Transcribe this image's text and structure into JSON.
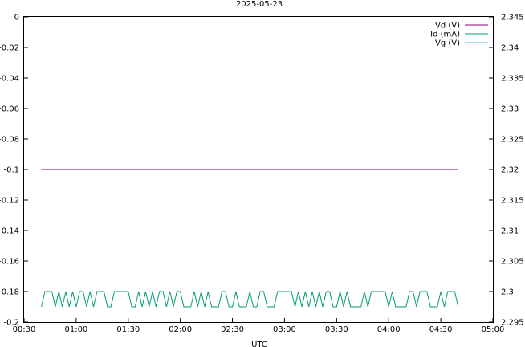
{
  "chart_data": {
    "type": "line",
    "title": "2025-05-23",
    "xlabel": "UTC",
    "x_unit": "time of day (UTC)",
    "xlim": [
      "00:30",
      "05:00"
    ],
    "ylim_left": [
      -0.2,
      0
    ],
    "ylim_right": [
      2.295,
      2.345
    ],
    "x_ticks": [
      "00:30",
      "01:00",
      "01:30",
      "02:00",
      "02:30",
      "03:00",
      "03:30",
      "04:00",
      "04:30",
      "05:00"
    ],
    "y_ticks_left": [
      "0",
      "-0.02",
      "-0.04",
      "-0.06",
      "-0.08",
      "-0.1",
      "-0.12",
      "-0.14",
      "-0.16",
      "-0.18",
      "-0.2"
    ],
    "y_ticks_right": [
      "2.345",
      "2.34",
      "2.335",
      "2.33",
      "2.325",
      "2.32",
      "2.315",
      "2.31",
      "2.305",
      "2.3",
      "2.295"
    ],
    "legend_position": "top-right",
    "grid": false,
    "series": [
      {
        "name": "Vd (V)",
        "axis": "right",
        "color": "#94007f",
        "x": [
          "00:40",
          "04:40"
        ],
        "values": [
          2.32,
          2.32
        ]
      },
      {
        "name": "Id (mA)",
        "axis": "left",
        "color": "#009e73",
        "x": [
          "00:40",
          "00:42",
          "00:44",
          "00:46",
          "00:48",
          "00:50",
          "00:52",
          "00:54",
          "00:56",
          "00:58",
          "01:00",
          "01:02",
          "01:04",
          "01:06",
          "01:08",
          "01:10",
          "01:12",
          "01:14",
          "01:16",
          "01:18",
          "01:20",
          "01:22",
          "01:24",
          "01:26",
          "01:28",
          "01:30",
          "01:32",
          "01:34",
          "01:36",
          "01:38",
          "01:40",
          "01:42",
          "01:44",
          "01:46",
          "01:48",
          "01:50",
          "01:52",
          "01:54",
          "01:56",
          "01:58",
          "02:00",
          "02:02",
          "02:04",
          "02:06",
          "02:08",
          "02:10",
          "02:12",
          "02:14",
          "02:16",
          "02:18",
          "02:20",
          "02:22",
          "02:24",
          "02:26",
          "02:28",
          "02:30",
          "02:32",
          "02:34",
          "02:36",
          "02:38",
          "02:40",
          "02:42",
          "02:44",
          "02:46",
          "02:48",
          "02:50",
          "02:52",
          "02:54",
          "02:56",
          "02:58",
          "03:00",
          "03:02",
          "03:04",
          "03:06",
          "03:08",
          "03:10",
          "03:12",
          "03:14",
          "03:16",
          "03:18",
          "03:20",
          "03:22",
          "03:24",
          "03:26",
          "03:28",
          "03:30",
          "03:32",
          "03:34",
          "03:36",
          "03:38",
          "03:40",
          "03:42",
          "03:44",
          "03:46",
          "03:48",
          "03:50",
          "03:52",
          "03:54",
          "03:56",
          "03:58",
          "04:00",
          "04:02",
          "04:04",
          "04:06",
          "04:08",
          "04:10",
          "04:12",
          "04:14",
          "04:16",
          "04:18",
          "04:20",
          "04:22",
          "04:24",
          "04:26",
          "04:28",
          "04:30",
          "04:32",
          "04:34",
          "04:36",
          "04:38",
          "04:40"
        ],
        "values": [
          -0.19,
          -0.18,
          -0.18,
          -0.18,
          -0.19,
          -0.18,
          -0.19,
          -0.18,
          -0.19,
          -0.18,
          -0.19,
          -0.18,
          -0.18,
          -0.19,
          -0.18,
          -0.19,
          -0.18,
          -0.18,
          -0.18,
          -0.19,
          -0.19,
          -0.18,
          -0.18,
          -0.18,
          -0.18,
          -0.18,
          -0.19,
          -0.19,
          -0.18,
          -0.19,
          -0.18,
          -0.19,
          -0.18,
          -0.19,
          -0.18,
          -0.18,
          -0.19,
          -0.18,
          -0.19,
          -0.18,
          -0.18,
          -0.19,
          -0.19,
          -0.19,
          -0.18,
          -0.19,
          -0.18,
          -0.19,
          -0.18,
          -0.19,
          -0.19,
          -0.19,
          -0.18,
          -0.18,
          -0.19,
          -0.19,
          -0.18,
          -0.19,
          -0.19,
          -0.19,
          -0.18,
          -0.19,
          -0.19,
          -0.18,
          -0.18,
          -0.19,
          -0.19,
          -0.19,
          -0.18,
          -0.18,
          -0.18,
          -0.18,
          -0.18,
          -0.19,
          -0.18,
          -0.19,
          -0.18,
          -0.19,
          -0.18,
          -0.19,
          -0.18,
          -0.19,
          -0.18,
          -0.18,
          -0.19,
          -0.19,
          -0.18,
          -0.19,
          -0.18,
          -0.19,
          -0.19,
          -0.19,
          -0.19,
          -0.18,
          -0.19,
          -0.18,
          -0.18,
          -0.18,
          -0.18,
          -0.18,
          -0.19,
          -0.18,
          -0.19,
          -0.19,
          -0.19,
          -0.19,
          -0.18,
          -0.18,
          -0.19,
          -0.18,
          -0.18,
          -0.18,
          -0.19,
          -0.19,
          -0.19,
          -0.18,
          -0.19,
          -0.18,
          -0.18,
          -0.18,
          -0.19
        ]
      },
      {
        "name": "Vg (V)",
        "axis": "left",
        "color": "#56b4e9",
        "x": [
          "00:40",
          "04:40"
        ],
        "values": [
          -0.1,
          -0.1
        ]
      }
    ]
  }
}
